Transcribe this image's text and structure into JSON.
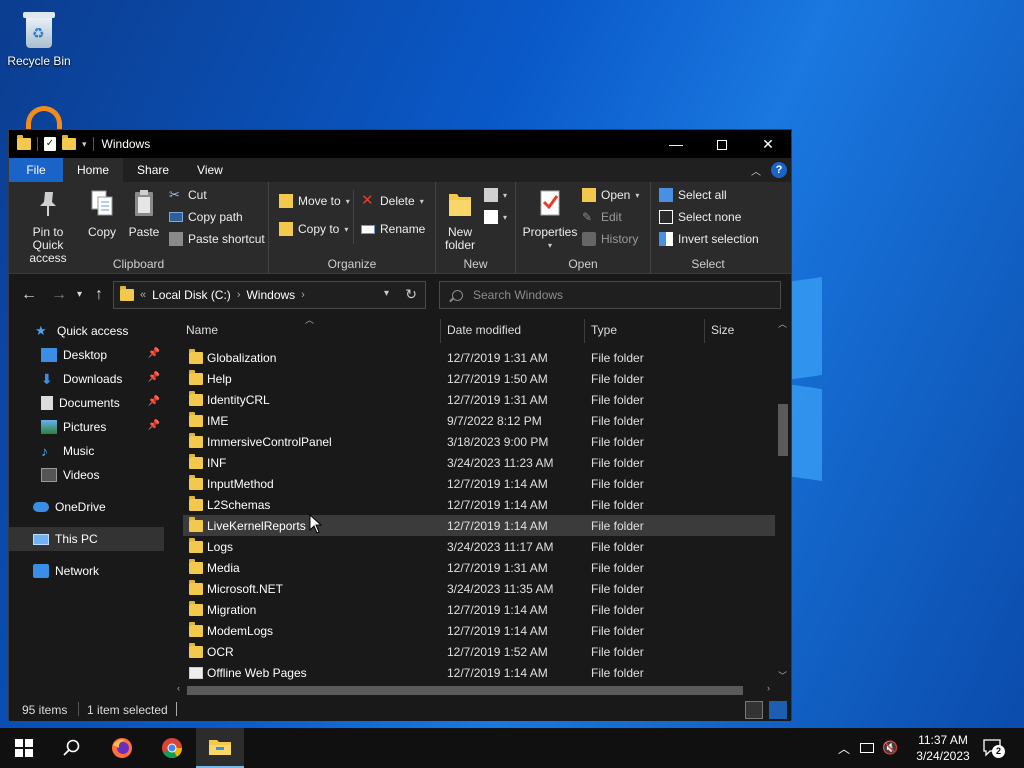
{
  "desktop": {
    "recycle_bin_label": "Recycle Bin"
  },
  "window": {
    "title": "Windows",
    "minimize": "—",
    "close": "✕"
  },
  "tabs": {
    "file": "File",
    "home": "Home",
    "share": "Share",
    "view": "View",
    "help": "?"
  },
  "ribbon": {
    "clipboard": {
      "group": "Clipboard",
      "pin": "Pin to Quick access",
      "copy": "Copy",
      "paste": "Paste",
      "cut": "Cut",
      "copy_path": "Copy path",
      "paste_shortcut": "Paste shortcut"
    },
    "organize": {
      "group": "Organize",
      "move_to": "Move to",
      "copy_to": "Copy to",
      "delete": "Delete",
      "rename": "Rename"
    },
    "new": {
      "group": "New",
      "new_folder": "New folder"
    },
    "open": {
      "group": "Open",
      "properties": "Properties",
      "open": "Open",
      "edit": "Edit",
      "history": "History"
    },
    "select": {
      "group": "Select",
      "select_all": "Select all",
      "select_none": "Select none",
      "invert": "Invert selection"
    }
  },
  "address": {
    "prefix": "«",
    "seg1": "Local Disk (C:)",
    "seg2": "Windows",
    "search_placeholder": "Search Windows"
  },
  "nav": {
    "quick_access": "Quick access",
    "desktop": "Desktop",
    "downloads": "Downloads",
    "documents": "Documents",
    "pictures": "Pictures",
    "music": "Music",
    "videos": "Videos",
    "onedrive": "OneDrive",
    "this_pc": "This PC",
    "network": "Network"
  },
  "columns": {
    "name": "Name",
    "date": "Date modified",
    "type": "Type",
    "size": "Size"
  },
  "files": [
    {
      "name": "Globalization",
      "date": "12/7/2019 1:31 AM",
      "type": "File folder"
    },
    {
      "name": "Help",
      "date": "12/7/2019 1:50 AM",
      "type": "File folder"
    },
    {
      "name": "IdentityCRL",
      "date": "12/7/2019 1:31 AM",
      "type": "File folder"
    },
    {
      "name": "IME",
      "date": "9/7/2022 8:12 PM",
      "type": "File folder"
    },
    {
      "name": "ImmersiveControlPanel",
      "date": "3/18/2023 9:00 PM",
      "type": "File folder"
    },
    {
      "name": "INF",
      "date": "3/24/2023 11:23 AM",
      "type": "File folder"
    },
    {
      "name": "InputMethod",
      "date": "12/7/2019 1:14 AM",
      "type": "File folder"
    },
    {
      "name": "L2Schemas",
      "date": "12/7/2019 1:14 AM",
      "type": "File folder"
    },
    {
      "name": "LiveKernelReports",
      "date": "12/7/2019 1:14 AM",
      "type": "File folder"
    },
    {
      "name": "Logs",
      "date": "3/24/2023 11:17 AM",
      "type": "File folder"
    },
    {
      "name": "Media",
      "date": "12/7/2019 1:31 AM",
      "type": "File folder"
    },
    {
      "name": "Microsoft.NET",
      "date": "3/24/2023 11:35 AM",
      "type": "File folder"
    },
    {
      "name": "Migration",
      "date": "12/7/2019 1:14 AM",
      "type": "File folder"
    },
    {
      "name": "ModemLogs",
      "date": "12/7/2019 1:14 AM",
      "type": "File folder"
    },
    {
      "name": "OCR",
      "date": "12/7/2019 1:52 AM",
      "type": "File folder"
    },
    {
      "name": "Offline Web Pages",
      "date": "12/7/2019 1:14 AM",
      "type": "File folder"
    }
  ],
  "selected_file": "LiveKernelReports",
  "status": {
    "items": "95 items",
    "selected": "1 item selected"
  },
  "taskbar": {
    "time": "11:37 AM",
    "date": "3/24/2023",
    "notifications": "2"
  },
  "colors": {
    "accent": "#1a64c8",
    "folder": "#f2c94c"
  }
}
